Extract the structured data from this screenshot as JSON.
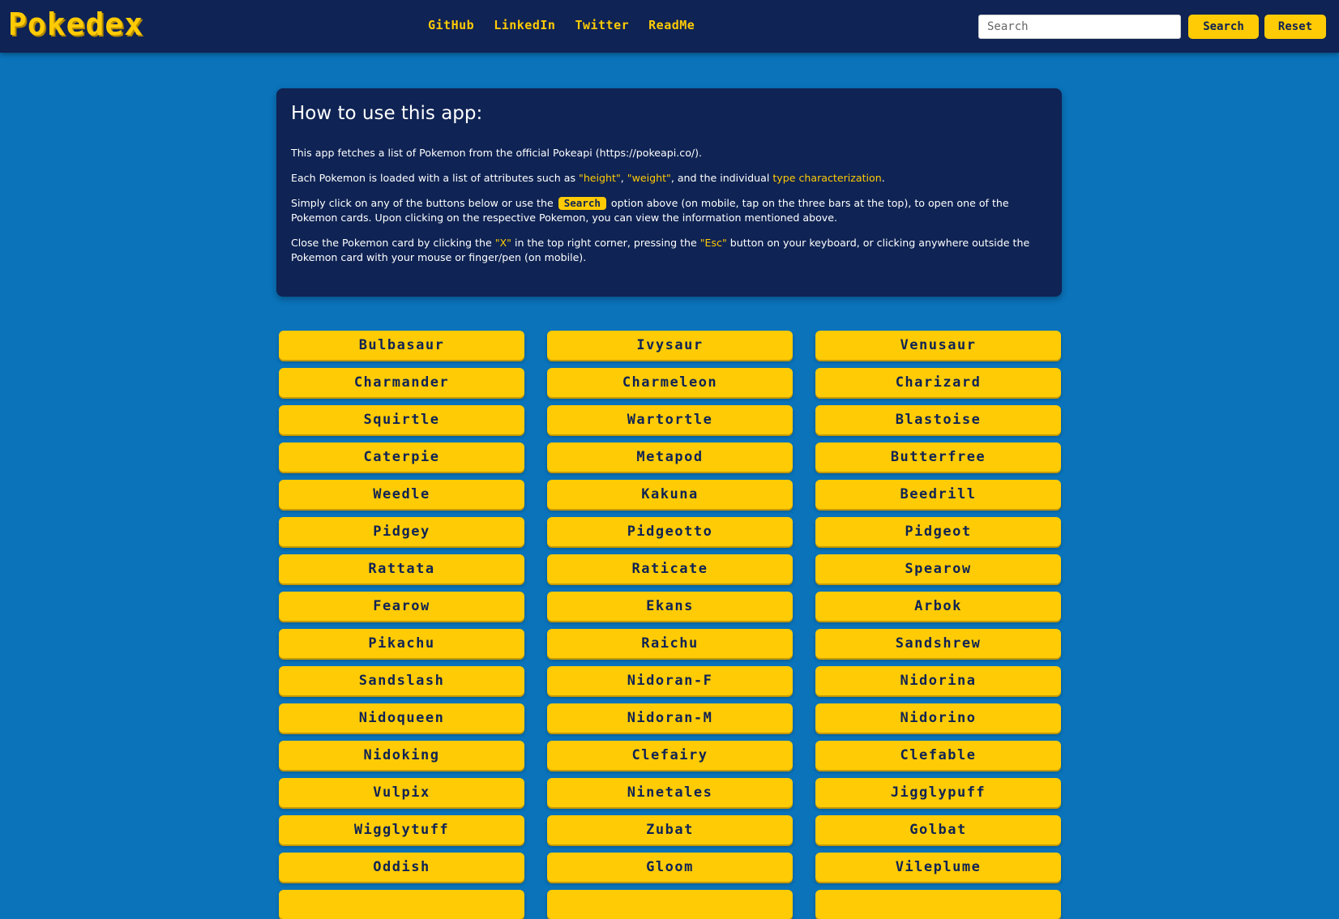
{
  "header": {
    "brand": "Pokedex",
    "nav": [
      "GitHub",
      "LinkedIn",
      "Twitter",
      "ReadMe"
    ],
    "search_placeholder": "Search",
    "search_button": "Search",
    "reset_button": "Reset"
  },
  "info": {
    "title": "How to use this app:",
    "p1": "This app fetches a list of Pokemon from the official Pokeapi (https://pokeapi.co/).",
    "p2_a": "Each Pokemon is loaded with a list of attributes such as ",
    "p2_height": "\"height\"",
    "p2_comma": ", ",
    "p2_weight": "\"weight\"",
    "p2_b": ", and the individual ",
    "p2_type": "type characterization",
    "p2_end": ".",
    "p3_a": "Simply click on any of the buttons below or use the ",
    "p3_badge": "Search",
    "p3_b": " option above (on mobile, tap on the three bars at the top), to open one of the Pokemon cards. Upon clicking on the respective Pokemon, you can view the information mentioned above.",
    "p4_a": "Close the Pokemon card by clicking the ",
    "p4_x": "\"X\"",
    "p4_b": " in the top right corner, pressing the ",
    "p4_esc": "\"Esc\"",
    "p4_c": " button on your keyboard, or clicking anywhere outside the Pokemon card with your mouse or finger/pen (on mobile)."
  },
  "pokemon": [
    "Bulbasaur",
    "Ivysaur",
    "Venusaur",
    "Charmander",
    "Charmeleon",
    "Charizard",
    "Squirtle",
    "Wartortle",
    "Blastoise",
    "Caterpie",
    "Metapod",
    "Butterfree",
    "Weedle",
    "Kakuna",
    "Beedrill",
    "Pidgey",
    "Pidgeotto",
    "Pidgeot",
    "Rattata",
    "Raticate",
    "Spearow",
    "Fearow",
    "Ekans",
    "Arbok",
    "Pikachu",
    "Raichu",
    "Sandshrew",
    "Sandslash",
    "Nidoran-F",
    "Nidorina",
    "Nidoqueen",
    "Nidoran-M",
    "Nidorino",
    "Nidoking",
    "Clefairy",
    "Clefable",
    "Vulpix",
    "Ninetales",
    "Jigglypuff",
    "Wigglytuff",
    "Zubat",
    "Golbat",
    "Oddish",
    "Gloom",
    "Vileplume"
  ],
  "colors": {
    "background": "#0a73ba",
    "navbar": "#0f2354",
    "accent": "#ffcb05"
  }
}
